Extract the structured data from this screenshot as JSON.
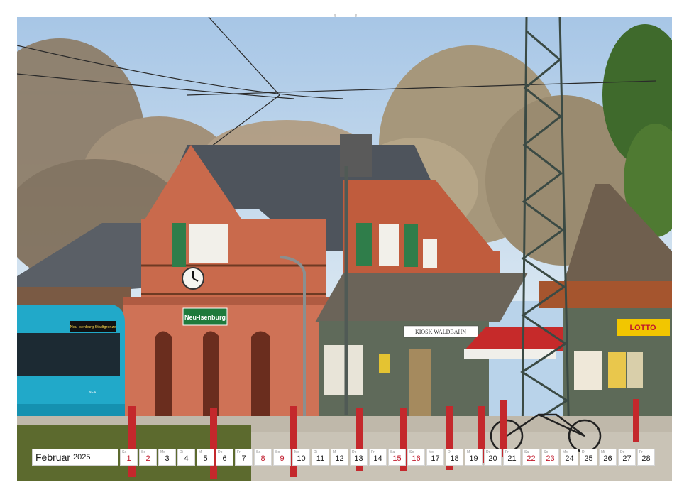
{
  "photo": {
    "description_icon": "photograph",
    "station_sign": "Neu-Isenburg",
    "kiosk_sign": "KIOSK WALDBAHN",
    "lotto_sign": "LOTTO",
    "tram_destination": "Neu-Isenburg Stadtgrenze",
    "tram_number": "NEA"
  },
  "calendar": {
    "month": "Februar",
    "year": "2025",
    "days": [
      {
        "wd": "Sa",
        "n": "1",
        "weekend": true
      },
      {
        "wd": "So",
        "n": "2",
        "weekend": true
      },
      {
        "wd": "Mo",
        "n": "3",
        "weekend": false
      },
      {
        "wd": "Di",
        "n": "4",
        "weekend": false
      },
      {
        "wd": "Mi",
        "n": "5",
        "weekend": false
      },
      {
        "wd": "Do",
        "n": "6",
        "weekend": false
      },
      {
        "wd": "Fr",
        "n": "7",
        "weekend": false
      },
      {
        "wd": "Sa",
        "n": "8",
        "weekend": true
      },
      {
        "wd": "So",
        "n": "9",
        "weekend": true
      },
      {
        "wd": "Mo",
        "n": "10",
        "weekend": false
      },
      {
        "wd": "Di",
        "n": "11",
        "weekend": false
      },
      {
        "wd": "Mi",
        "n": "12",
        "weekend": false
      },
      {
        "wd": "Do",
        "n": "13",
        "weekend": false
      },
      {
        "wd": "Fr",
        "n": "14",
        "weekend": false
      },
      {
        "wd": "Sa",
        "n": "15",
        "weekend": true
      },
      {
        "wd": "So",
        "n": "16",
        "weekend": true
      },
      {
        "wd": "Mo",
        "n": "17",
        "weekend": false
      },
      {
        "wd": "Di",
        "n": "18",
        "weekend": false
      },
      {
        "wd": "Mi",
        "n": "19",
        "weekend": false
      },
      {
        "wd": "Do",
        "n": "20",
        "weekend": false
      },
      {
        "wd": "Fr",
        "n": "21",
        "weekend": false
      },
      {
        "wd": "Sa",
        "n": "22",
        "weekend": true
      },
      {
        "wd": "So",
        "n": "23",
        "weekend": true
      },
      {
        "wd": "Mo",
        "n": "24",
        "weekend": false
      },
      {
        "wd": "Di",
        "n": "25",
        "weekend": false
      },
      {
        "wd": "Mi",
        "n": "26",
        "weekend": false
      },
      {
        "wd": "Do",
        "n": "27",
        "weekend": false
      },
      {
        "wd": "Fr",
        "n": "28",
        "weekend": false
      }
    ]
  },
  "colors": {
    "sky": "#b9d3ea",
    "brick": "#c96a4c",
    "roof": "#4e545c",
    "shutter_green": "#2f7d4a",
    "tram_cyan": "#21a9c9",
    "weekend_red": "#c0182a",
    "bollard_red": "#c4282c"
  }
}
